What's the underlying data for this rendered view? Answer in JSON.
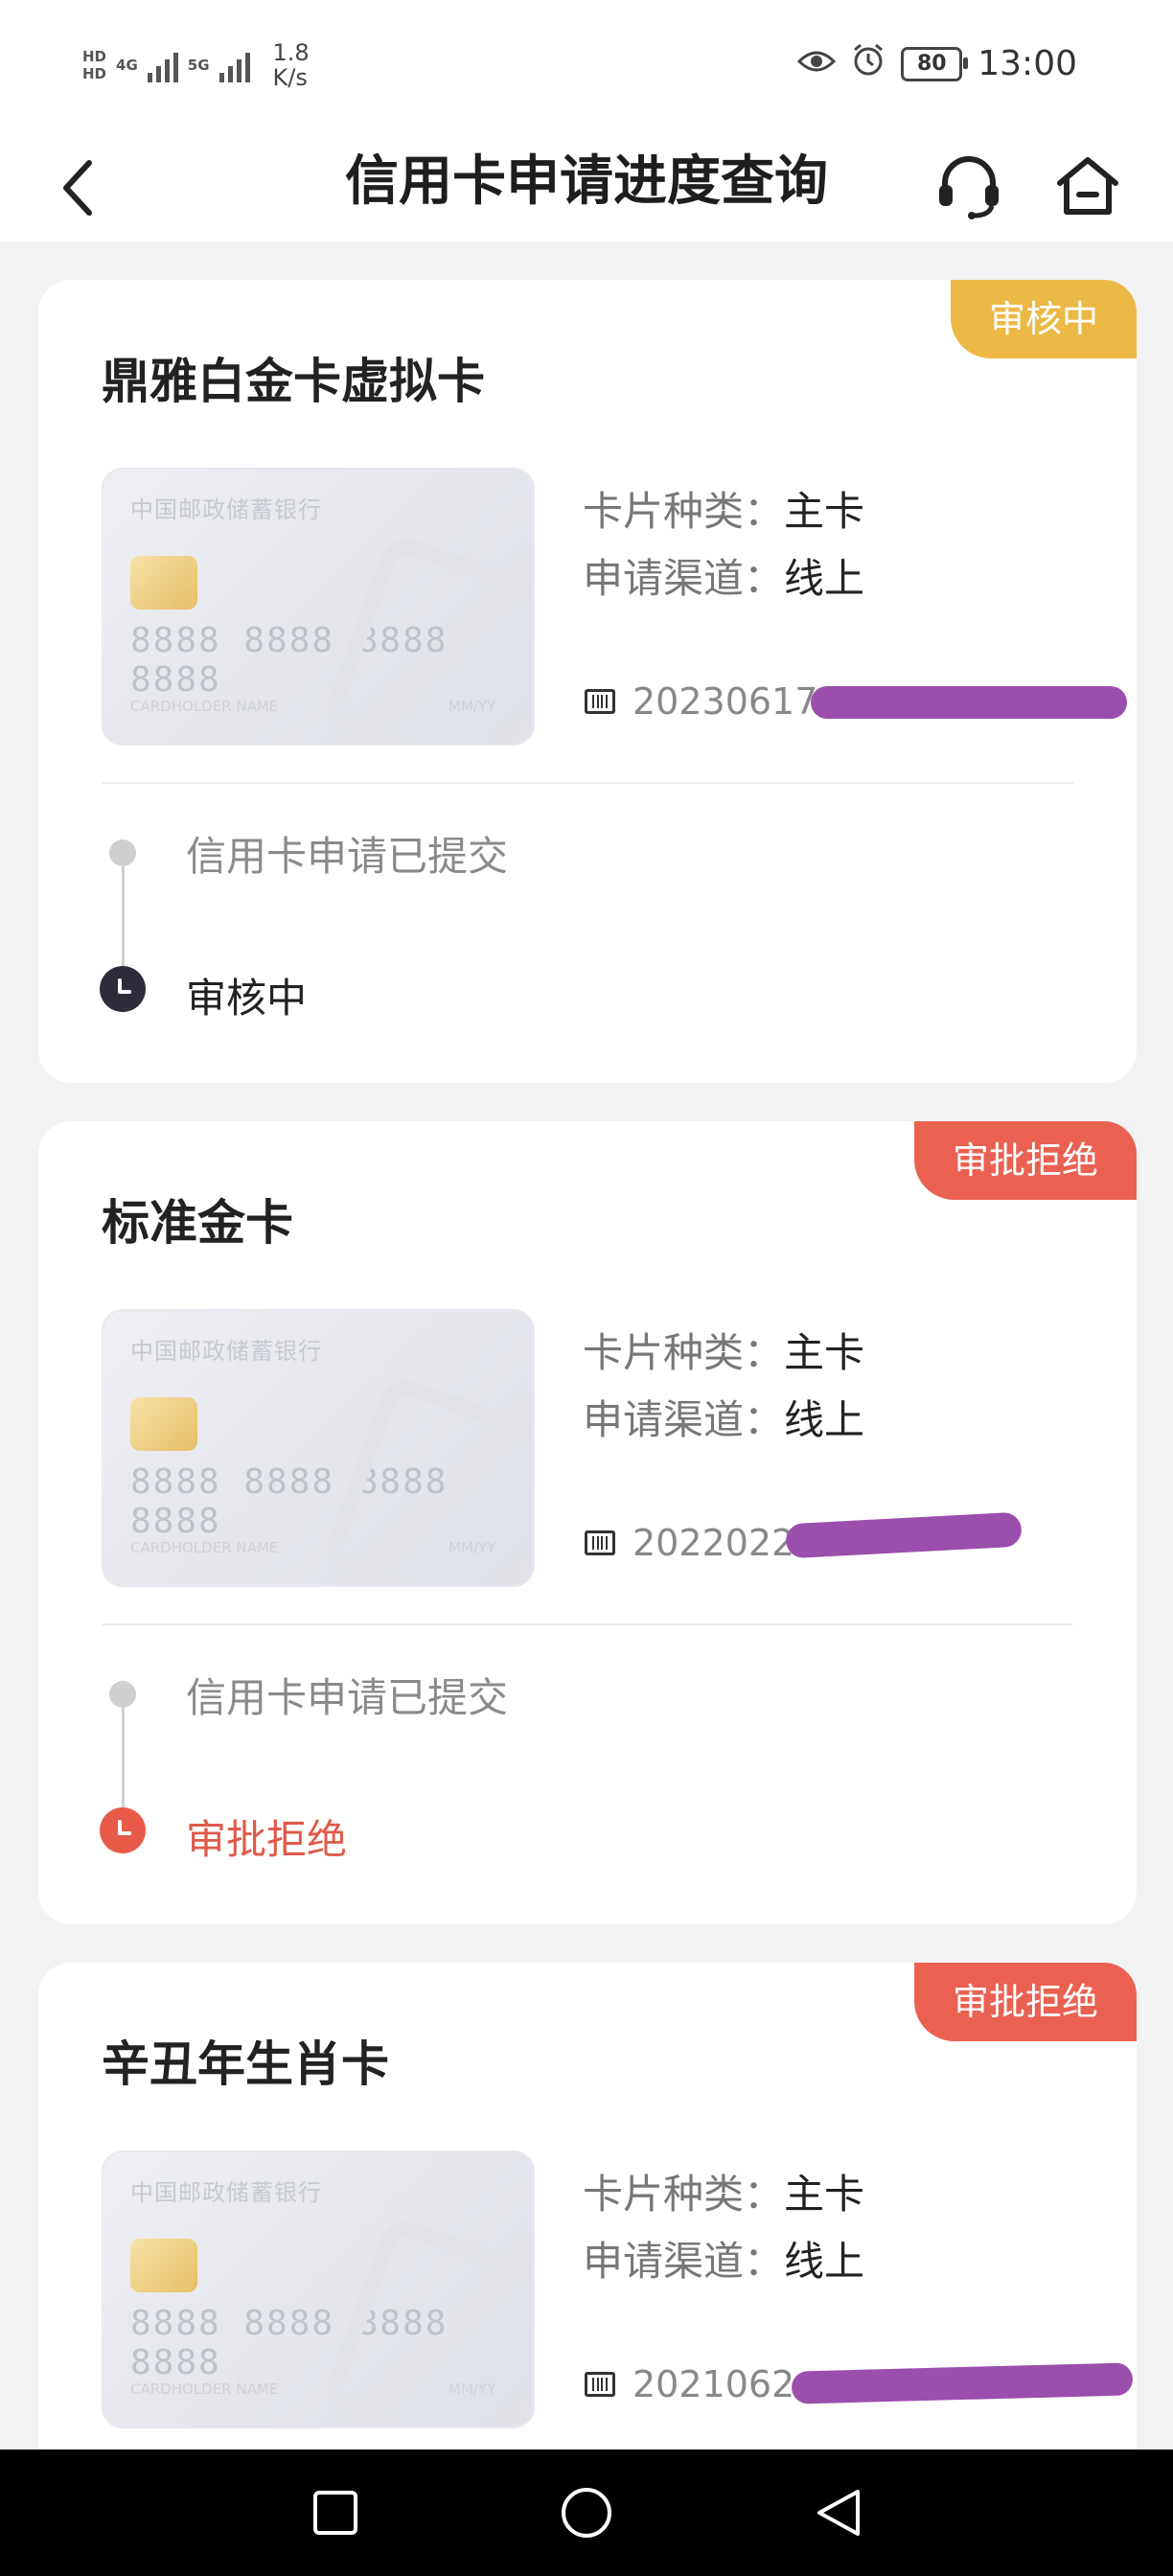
{
  "status_bar": {
    "hd1": "HD",
    "hd2": "HD",
    "net1": "4G",
    "net2": "5G",
    "speed_value": "1.8",
    "speed_unit": "K/s",
    "battery": "80",
    "time": "13:00"
  },
  "header": {
    "title": "信用卡申请进度查询"
  },
  "cards": [
    {
      "name": "鼎雅白金卡虚拟卡",
      "badge": "审核中",
      "card_image": {
        "bank": "中国邮政储蓄银行",
        "number": "8888 8888 8888 8888",
        "holder": "CARDHOLDER NAME",
        "expiry": "MM/YY"
      },
      "type_label": "卡片种类：",
      "type_value": "主卡",
      "channel_label": "申请渠道：",
      "channel_value": "线上",
      "app_no_visible": "20230617",
      "step1": "信用卡申请已提交",
      "step2": "审核中"
    },
    {
      "name": "标准金卡",
      "badge": "审批拒绝",
      "card_image": {
        "bank": "中国邮政储蓄银行",
        "number": "8888 8888 8888 8888",
        "holder": "CARDHOLDER NAME",
        "expiry": "MM/YY"
      },
      "type_label": "卡片种类：",
      "type_value": "主卡",
      "channel_label": "申请渠道：",
      "channel_value": "线上",
      "app_no_visible": "2022022",
      "step1": "信用卡申请已提交",
      "step2": "审批拒绝"
    },
    {
      "name": "辛丑年生肖卡",
      "badge": "审批拒绝",
      "card_image": {
        "bank": "中国邮政储蓄银行",
        "number": "8888 8888 8888 8888",
        "holder": "CARDHOLDER NAME",
        "expiry": "MM/YY"
      },
      "type_label": "卡片种类：",
      "type_value": "主卡",
      "channel_label": "申请渠道：",
      "channel_value": "线上",
      "app_no_visible": "2021062"
    }
  ],
  "colors": {
    "review_badge": "#ecb947",
    "reject_badge": "#ea6152",
    "redaction": "#9b4fad"
  },
  "icons": [
    "back-arrow-icon",
    "customer-service-headset-icon",
    "home-icon",
    "barcode-icon",
    "clock-icon",
    "nav-recent-square-icon",
    "nav-home-circle-icon",
    "nav-back-triangle-icon"
  ]
}
